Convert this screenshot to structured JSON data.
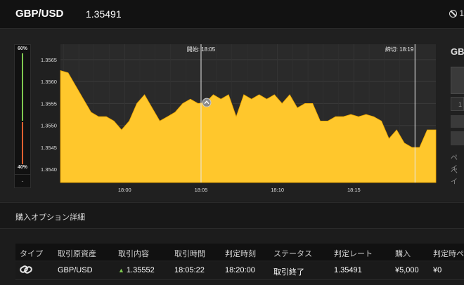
{
  "header": {
    "pair": "GBP/USD",
    "price": "1.35491",
    "right_text": "1"
  },
  "gauge": {
    "top_label": "60%",
    "bottom_label": "40%",
    "button_label": "-"
  },
  "side_panel": {
    "title": "GB",
    "input_value": "1",
    "text1": "ペイ",
    "text2": "ペイ"
  },
  "chart_data": {
    "type": "area",
    "y_ticks": [
      "1.3565",
      "1.3560",
      "1.3555",
      "1.3550",
      "1.3545",
      "1.3540"
    ],
    "x_ticks": [
      "18:00",
      "18:05",
      "18:10",
      "18:15"
    ],
    "ylim": [
      1.3537,
      1.35685
    ],
    "x_start": "17:55:48",
    "x_end": "18:20:22",
    "start_marker": {
      "label": "開始: 18:05",
      "time": "18:05:00"
    },
    "end_marker": {
      "label": "締切: 18:19",
      "time": "18:19:00"
    },
    "entry_point": {
      "time": "18:05:22",
      "value": 1.35552
    },
    "fill_color": "#ffc72c",
    "x": [
      "17:55:48",
      "17:56:18",
      "17:56:48",
      "17:57:18",
      "17:57:48",
      "17:58:18",
      "17:58:48",
      "17:59:18",
      "17:59:48",
      "18:00:18",
      "18:00:48",
      "18:01:18",
      "18:01:48",
      "18:02:18",
      "18:02:48",
      "18:03:18",
      "18:03:48",
      "18:04:18",
      "18:04:48",
      "18:05:18",
      "18:05:48",
      "18:06:18",
      "18:06:48",
      "18:07:18",
      "18:07:48",
      "18:08:18",
      "18:08:48",
      "18:09:18",
      "18:09:48",
      "18:10:18",
      "18:10:48",
      "18:11:18",
      "18:11:48",
      "18:12:18",
      "18:12:48",
      "18:13:18",
      "18:13:48",
      "18:14:18",
      "18:14:48",
      "18:15:18",
      "18:15:48",
      "18:16:18",
      "18:16:48",
      "18:17:18",
      "18:17:48",
      "18:18:18",
      "18:18:48",
      "18:19:18",
      "18:19:48",
      "18:20:22"
    ],
    "values": [
      1.35625,
      1.3562,
      1.3559,
      1.3556,
      1.3553,
      1.3552,
      1.3552,
      1.3551,
      1.3549,
      1.3551,
      1.3555,
      1.3557,
      1.3554,
      1.3551,
      1.3552,
      1.3553,
      1.3555,
      1.3556,
      1.3555,
      1.35552,
      1.3557,
      1.3556,
      1.3557,
      1.3552,
      1.3557,
      1.3556,
      1.3557,
      1.3556,
      1.3557,
      1.3555,
      1.3557,
      1.3554,
      1.3555,
      1.3555,
      1.3551,
      1.3551,
      1.3552,
      1.3552,
      1.35525,
      1.3552,
      1.35525,
      1.3552,
      1.3551,
      1.3547,
      1.3549,
      1.3546,
      1.3545,
      1.3545,
      1.3549,
      1.3549
    ]
  },
  "details": {
    "title": "購入オプション詳細",
    "columns": [
      "タイプ",
      "取引原資産",
      "取引内容",
      "取引時間",
      "判定時刻",
      "ステータス",
      "判定レート",
      "購入",
      "判定時ペイ"
    ],
    "row": {
      "type_icon": "link-icon",
      "asset": "GBP/USD",
      "direction_arrow": "▲",
      "entry_rate": "1.35552",
      "trade_time": "18:05:22",
      "judge_time": "18:20:00",
      "status": "取引終了",
      "judge_rate": "1.35491",
      "purchase": "¥5,000",
      "payout": "¥0"
    }
  }
}
